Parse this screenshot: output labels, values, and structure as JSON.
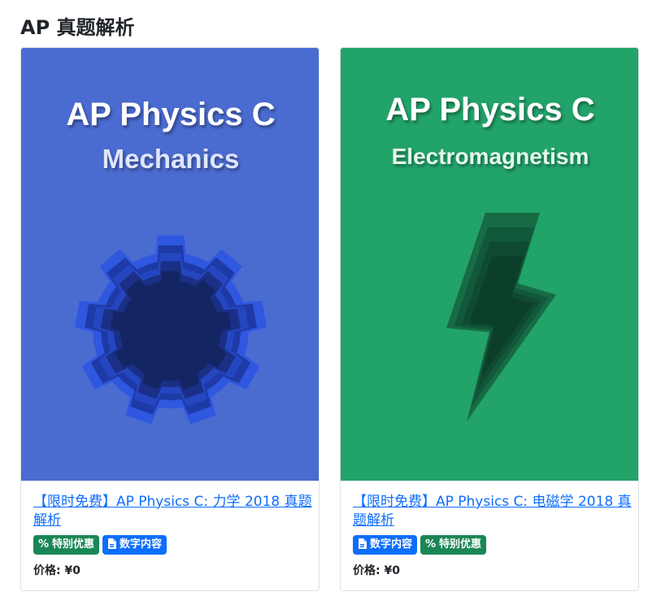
{
  "section": {
    "title": "AP 真题解析"
  },
  "colors": {
    "card1_bg": "#4a6bd0",
    "card2_bg": "#22a36a",
    "badge_green": "#198754",
    "badge_blue": "#0d6efd",
    "link": "#0d6efd"
  },
  "cards": [
    {
      "cover": {
        "title": "AP Physics C",
        "subtitle": "Mechanics",
        "icon": "gear-icon"
      },
      "title": "【限时免费】AP Physics C: 力学 2018 真题解析",
      "badges": [
        {
          "label": "特别优惠",
          "icon": "percent-icon"
        },
        {
          "label": "数字内容",
          "icon": "document-icon"
        }
      ],
      "price": "价格: ¥0"
    },
    {
      "cover": {
        "title": "AP Physics C",
        "subtitle": "Electromagnetism",
        "icon": "lightning-icon"
      },
      "title": "【限时免费】AP Physics C: 电磁学 2018 真题解析",
      "badges": [
        {
          "label": "数字内容",
          "icon": "document-icon"
        },
        {
          "label": "特别优惠",
          "icon": "percent-icon"
        }
      ],
      "price": "价格: ¥0"
    }
  ]
}
